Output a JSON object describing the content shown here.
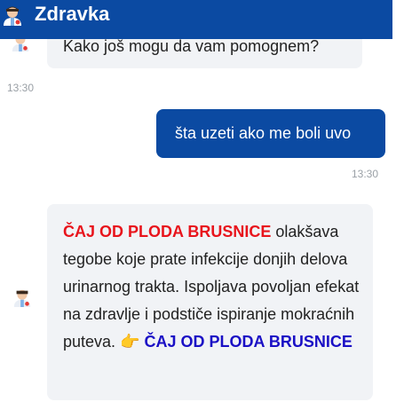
{
  "header": {
    "title": "Zdravka",
    "avatar_icon": "doctor-avatar-icon"
  },
  "messages": [
    {
      "sender": "bot",
      "text": "Kako još mogu da vam pomognem?",
      "time": "13:30"
    },
    {
      "sender": "user",
      "text": "šta uzeti ako me boli uvo",
      "time": "13:30"
    },
    {
      "sender": "bot",
      "highlight1": "ČAJ OD PLODA BRUSNICE",
      "body": " olakšava tegobe koje prate infekcije donjih delova urinarnog trakta. Ispoljava povoljan efekat na zdravlje i podstiče ispiranje mokraćnih puteva. ",
      "pointer_icon": "pointing-hand-icon",
      "highlight2": "ČAJ OD PLODA BRUSNICE"
    }
  ],
  "colors": {
    "header_bg": "#0b4aa2",
    "user_bubble": "#0b4aa2",
    "bot_bubble": "#f1f3f6",
    "highlight_red": "#e8141c",
    "highlight_blue": "#1a0fc5"
  }
}
